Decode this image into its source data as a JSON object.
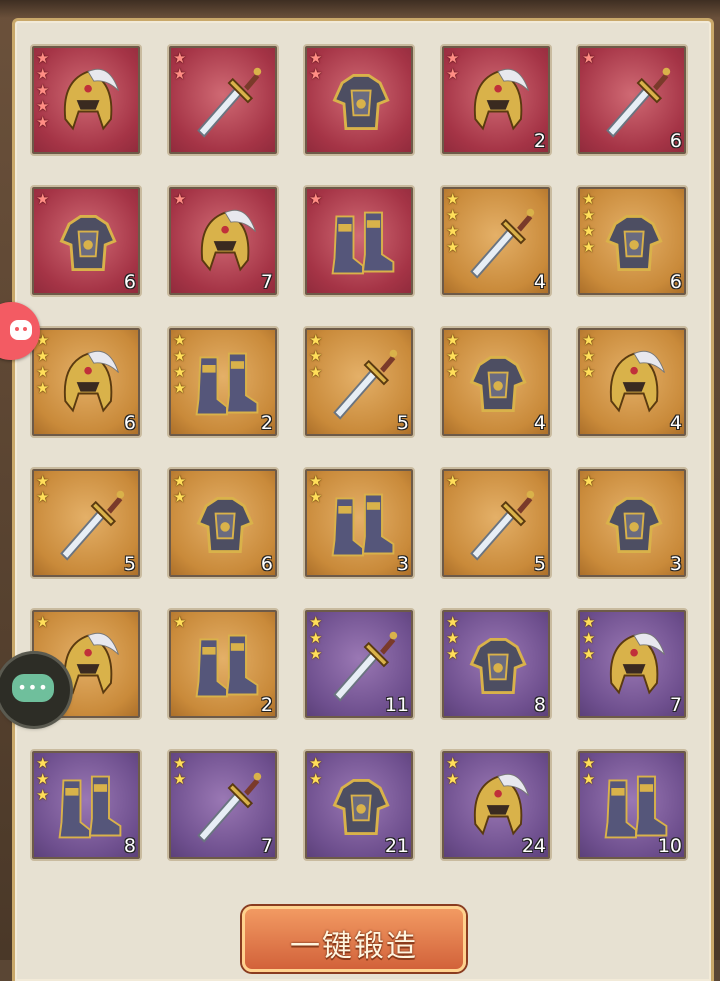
{
  "forge_button": {
    "label": "一键锻造"
  },
  "colors": {
    "red": "#a53446",
    "gold": "#c98a3a",
    "purple": "#6e4f8e",
    "star": "#ffde5a"
  },
  "items": [
    {
      "kind": "helmet",
      "rarity": "red",
      "stars": 5,
      "count": ""
    },
    {
      "kind": "sword",
      "rarity": "red",
      "stars": 2,
      "count": ""
    },
    {
      "kind": "armor",
      "rarity": "red",
      "stars": 2,
      "count": ""
    },
    {
      "kind": "helmet",
      "rarity": "red",
      "stars": 2,
      "count": "2"
    },
    {
      "kind": "sword",
      "rarity": "red",
      "stars": 1,
      "count": "6"
    },
    {
      "kind": "armor",
      "rarity": "red",
      "stars": 1,
      "count": "6"
    },
    {
      "kind": "helmet",
      "rarity": "red",
      "stars": 1,
      "count": "7"
    },
    {
      "kind": "boots",
      "rarity": "red",
      "stars": 1,
      "count": ""
    },
    {
      "kind": "sword",
      "rarity": "gold",
      "stars": 4,
      "count": "4"
    },
    {
      "kind": "armor",
      "rarity": "gold",
      "stars": 4,
      "count": "6"
    },
    {
      "kind": "helmet",
      "rarity": "gold",
      "stars": 4,
      "count": "6"
    },
    {
      "kind": "boots",
      "rarity": "gold",
      "stars": 4,
      "count": "2"
    },
    {
      "kind": "sword",
      "rarity": "gold",
      "stars": 3,
      "count": "5"
    },
    {
      "kind": "armor",
      "rarity": "gold",
      "stars": 3,
      "count": "4"
    },
    {
      "kind": "helmet",
      "rarity": "gold",
      "stars": 3,
      "count": "4"
    },
    {
      "kind": "sword",
      "rarity": "gold",
      "stars": 2,
      "count": "5"
    },
    {
      "kind": "armor",
      "rarity": "gold",
      "stars": 2,
      "count": "6"
    },
    {
      "kind": "boots",
      "rarity": "gold",
      "stars": 2,
      "count": "3"
    },
    {
      "kind": "sword",
      "rarity": "gold",
      "stars": 1,
      "count": "5"
    },
    {
      "kind": "armor",
      "rarity": "gold",
      "stars": 1,
      "count": "3"
    },
    {
      "kind": "helmet",
      "rarity": "gold",
      "stars": 1,
      "count": ""
    },
    {
      "kind": "boots",
      "rarity": "gold",
      "stars": 1,
      "count": "2"
    },
    {
      "kind": "sword",
      "rarity": "purple",
      "stars": 3,
      "count": "11"
    },
    {
      "kind": "armor",
      "rarity": "purple",
      "stars": 3,
      "count": "8"
    },
    {
      "kind": "helmet",
      "rarity": "purple",
      "stars": 3,
      "count": "7"
    },
    {
      "kind": "boots",
      "rarity": "purple",
      "stars": 3,
      "count": "8"
    },
    {
      "kind": "sword",
      "rarity": "purple",
      "stars": 2,
      "count": "7"
    },
    {
      "kind": "armor",
      "rarity": "purple",
      "stars": 2,
      "count": "21"
    },
    {
      "kind": "helmet",
      "rarity": "purple",
      "stars": 2,
      "count": "24"
    },
    {
      "kind": "boots",
      "rarity": "purple",
      "stars": 2,
      "count": "10"
    }
  ]
}
